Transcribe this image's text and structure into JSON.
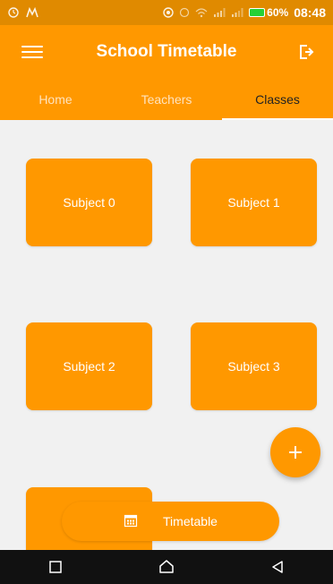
{
  "status_bar": {
    "battery": "60%",
    "time": "08:48"
  },
  "app_bar": {
    "title": "School Timetable"
  },
  "tabs": [
    {
      "label": "Home",
      "active": false
    },
    {
      "label": "Teachers",
      "active": false
    },
    {
      "label": "Classes",
      "active": true
    }
  ],
  "cards": [
    {
      "label": "Subject 0"
    },
    {
      "label": "Subject 1"
    },
    {
      "label": "Subject 2"
    },
    {
      "label": "Subject 3"
    },
    {
      "label": ""
    }
  ],
  "bottom_action": {
    "label": "Timetable",
    "icon": "calendar-icon"
  },
  "colors": {
    "primary": "#ff9800",
    "status_bar": "#e08a00",
    "background": "#f1f1f1",
    "nav_bar": "#111111"
  },
  "icons": {
    "menu": "menu-icon",
    "logout": "logout-icon",
    "fab": "plus-icon",
    "nav_back": "back-icon",
    "nav_home": "home-icon",
    "nav_recent": "recent-apps-icon"
  }
}
